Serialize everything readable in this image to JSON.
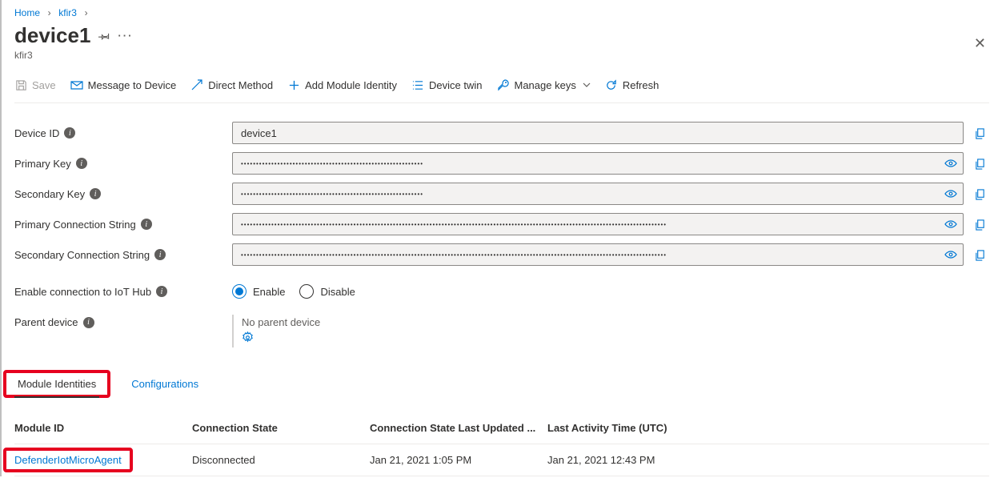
{
  "breadcrumb": {
    "home": "Home",
    "parent": "kfir3"
  },
  "header": {
    "title": "device1",
    "subtitle": "kfir3"
  },
  "toolbar": {
    "save": "Save",
    "message": "Message to Device",
    "direct_method": "Direct Method",
    "add_module": "Add Module Identity",
    "device_twin": "Device twin",
    "manage_keys": "Manage keys",
    "refresh": "Refresh"
  },
  "fields": {
    "device_id_label": "Device ID",
    "device_id_value": "device1",
    "primary_key_label": "Primary Key",
    "primary_key_value": "••••••••••••••••••••••••••••••••••••••••••••••••••••••••••••",
    "secondary_key_label": "Secondary Key",
    "secondary_key_value": "••••••••••••••••••••••••••••••••••••••••••••••••••••••••••••",
    "primary_cs_label": "Primary Connection String",
    "primary_cs_value": "••••••••••••••••••••••••••••••••••••••••••••••••••••••••••••••••••••••••••••••••••••••••••••••••••••••••••••••••••••••••••••••••••••••••••••",
    "secondary_cs_label": "Secondary Connection String",
    "secondary_cs_value": "••••••••••••••••••••••••••••••••••••••••••••••••••••••••••••••••••••••••••••••••••••••••••••••••••••••••••••••••••••••••••••••••••••••••••••",
    "enable_label": "Enable connection to IoT Hub",
    "enable_option": "Enable",
    "disable_option": "Disable",
    "parent_label": "Parent device",
    "parent_value": "No parent device"
  },
  "tabs": {
    "module_identities": "Module Identities",
    "configurations": "Configurations"
  },
  "table": {
    "headers": {
      "module_id": "Module ID",
      "conn_state": "Connection State",
      "conn_updated": "Connection State Last Updated ...",
      "last_activity": "Last Activity Time (UTC)"
    },
    "rows": [
      {
        "module_id": "DefenderIotMicroAgent",
        "conn_state": "Disconnected",
        "conn_updated": "Jan 21, 2021 1:05 PM",
        "last_activity": "Jan 21, 2021 12:43 PM"
      }
    ]
  }
}
